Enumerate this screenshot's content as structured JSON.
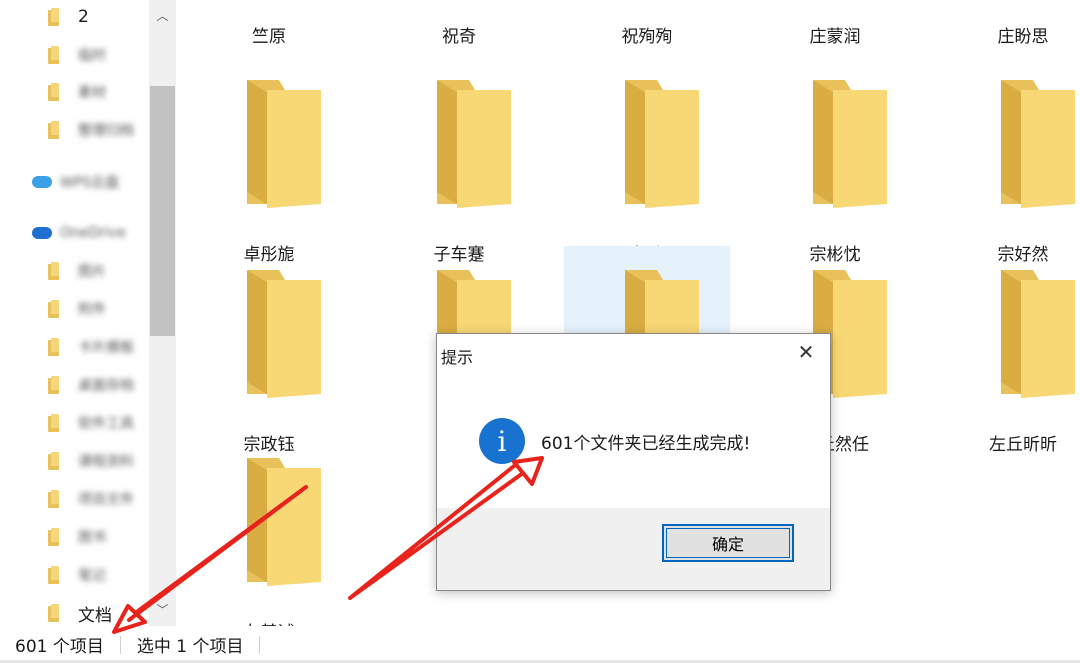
{
  "sidebar": {
    "items": [
      {
        "label": "2",
        "type": "folder",
        "blurred": false
      },
      {
        "label": "临时",
        "type": "folder",
        "blurred": true
      },
      {
        "label": "素材",
        "type": "folder",
        "blurred": true
      },
      {
        "label": "整理归档",
        "type": "folder",
        "blurred": true
      },
      {
        "label": "WPS云盘",
        "type": "cloud",
        "blurred": true
      },
      {
        "label": "OneDrive",
        "type": "cloud",
        "blurred": true
      },
      {
        "label": "图片",
        "type": "folder",
        "blurred": true
      },
      {
        "label": "附件",
        "type": "folder",
        "blurred": true
      },
      {
        "label": "卡片模板",
        "type": "folder",
        "blurred": true
      },
      {
        "label": "桌面存档",
        "type": "folder",
        "blurred": true
      },
      {
        "label": "软件工具",
        "type": "folder",
        "blurred": true
      },
      {
        "label": "课程资料",
        "type": "folder",
        "blurred": true
      },
      {
        "label": "项目文件",
        "type": "folder",
        "blurred": true
      },
      {
        "label": "图书",
        "type": "folder",
        "blurred": true
      },
      {
        "label": "笔记",
        "type": "folder",
        "blurred": true
      },
      {
        "label": "文档",
        "type": "folder",
        "blurred": false
      }
    ]
  },
  "folders": {
    "row1": [
      "竺原",
      "祝奇",
      "祝殉殉",
      "庄蒙润",
      "庄盼思"
    ],
    "row2": [
      "卓彤旎",
      "子车蹇",
      "子车玲露",
      "宗彬忱",
      "宗好然"
    ],
    "row3": [
      "宗政钰",
      "",
      "",
      "左丘然任",
      "左丘昕昕"
    ],
    "row4": [
      "左綦诚"
    ]
  },
  "statusbar": {
    "item_count": "601 个项目",
    "selected": "选中 1 个项目"
  },
  "dialog": {
    "title": "提示",
    "close_glyph": "✕",
    "icon_glyph": "i",
    "message": "601个文件夹已经生成完成!",
    "ok_label": "确定"
  },
  "colors": {
    "folder_back": "#e8c15a",
    "folder_front": "#f8d775",
    "selection": "#e5f1fb",
    "info_blue": "#1772d0",
    "arrow_red": "#e8231c",
    "button_border": "#0067c0"
  }
}
